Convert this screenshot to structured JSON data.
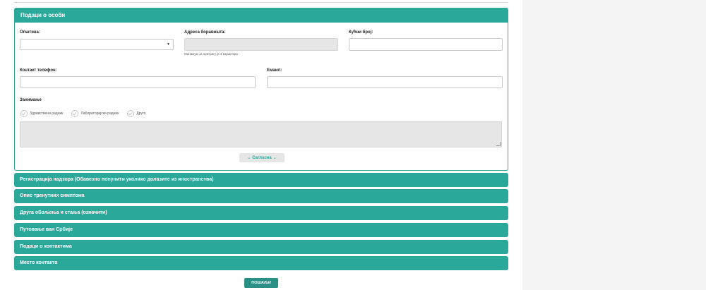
{
  "panel": {
    "title": "Подаци о особи",
    "municipality_label": "Општина:",
    "address_label": "Адреса боравишта:",
    "address_hint": "Минимум за претрагу је 3 карактера",
    "house_number_label": "Кућни број:",
    "phone_label": "Контакт телефон:",
    "email_label": "Емаил:",
    "occupation_label": "Занимање",
    "occupation_options": [
      "Здравствени радник",
      "Лабораторијски радник",
      "Друго"
    ],
    "consent_label": "Сагласна"
  },
  "accordion": [
    "Регистрација надзора (Обавезно попунити уколико долазите из иностранства)",
    "Опис тренутних симптома",
    "Друга обољења и стања (означити)",
    "Путовање ван Србије",
    "Подаци о контактима",
    "Место контакта"
  ],
  "submit_label": "ПОШАЉИ",
  "colors": {
    "accent": "#2aa89a",
    "submit": "#2a8f84"
  }
}
